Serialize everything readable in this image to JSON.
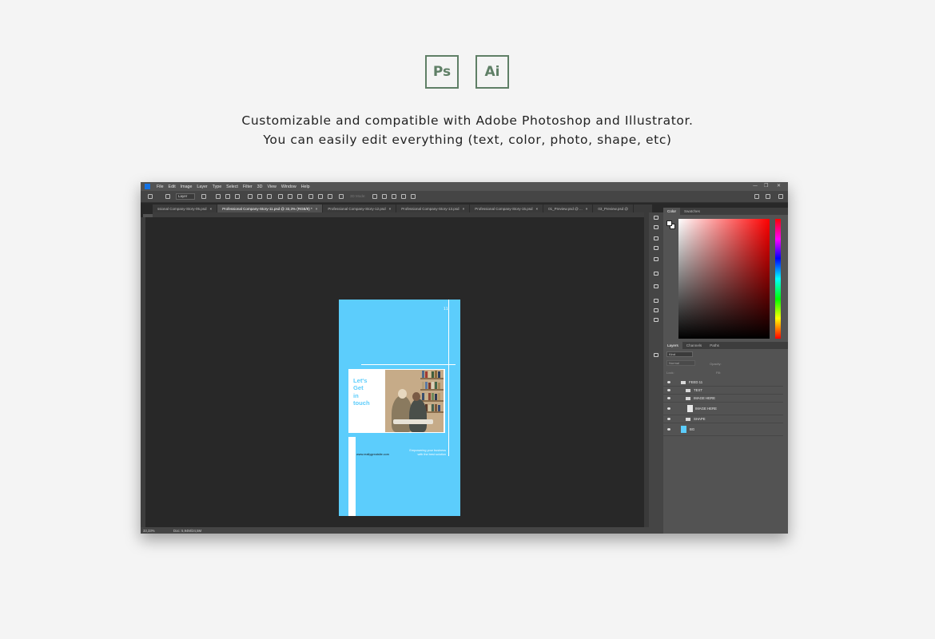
{
  "badges": {
    "ps": "Ps",
    "ai": "Ai"
  },
  "tagline": {
    "line1": "Customizable and compatible with Adobe Photoshop and Illustrator.",
    "line2": "You can easily edit everything (text, color, photo, shape, etc)"
  },
  "photoshop": {
    "logo": "Ps",
    "menu": [
      "File",
      "Edit",
      "Image",
      "Layer",
      "Type",
      "Select",
      "Filter",
      "3D",
      "View",
      "Window",
      "Help"
    ],
    "window_controls": {
      "minimize": "—",
      "restore": "❐",
      "close": "✕"
    },
    "options": {
      "auto_select": "Layer",
      "mode_3d": "3D Mode:"
    },
    "tabs": [
      {
        "label": "ssional Company-Story-05.psd",
        "active": false
      },
      {
        "label": "Professional Company-Story-11.psd @ 33,3% (RGB/8) *",
        "active": true
      },
      {
        "label": "Professional Company-Story-12.psd",
        "active": false
      },
      {
        "label": "Professional Company-Story-13.psd",
        "active": false
      },
      {
        "label": "Professional Company-Story-15.psd",
        "active": false
      },
      {
        "label": "01_Preview.psd @ ...",
        "active": false
      },
      {
        "label": "03_Preview.psd @",
        "active": false
      }
    ],
    "tab_close": "×",
    "document": {
      "page_number": "11",
      "headline": [
        "Let's",
        "Get",
        "in",
        "touch"
      ],
      "url": "www.reallygreatsite.com",
      "slogan": [
        "Empowering your business",
        "with the best solution"
      ],
      "background_color": "#5ccdfc"
    },
    "status": {
      "zoom": "33,33%",
      "doc_size": "Doc: 5,94M/24,5M"
    },
    "color_panel": {
      "tabs": [
        "Color",
        "Swatches"
      ]
    },
    "layers_panel": {
      "tabs": [
        "Layers",
        "Channels",
        "Paths"
      ],
      "filter": "Kind",
      "blend_mode": "Normal",
      "opacity_label": "Opacity:",
      "lock_label": "Lock:",
      "fill_label": "Fill:",
      "layers": [
        {
          "name": "FEED 11",
          "type": "group",
          "indent": 0
        },
        {
          "name": "TEXT",
          "type": "group",
          "indent": 1
        },
        {
          "name": "IMAGE HERE",
          "type": "group",
          "indent": 1
        },
        {
          "name": "IMAGE HERE",
          "type": "smart-object",
          "indent": 2
        },
        {
          "name": "SHAPE",
          "type": "group",
          "indent": 1
        },
        {
          "name": "BG",
          "type": "fill",
          "indent": 1
        }
      ]
    }
  }
}
